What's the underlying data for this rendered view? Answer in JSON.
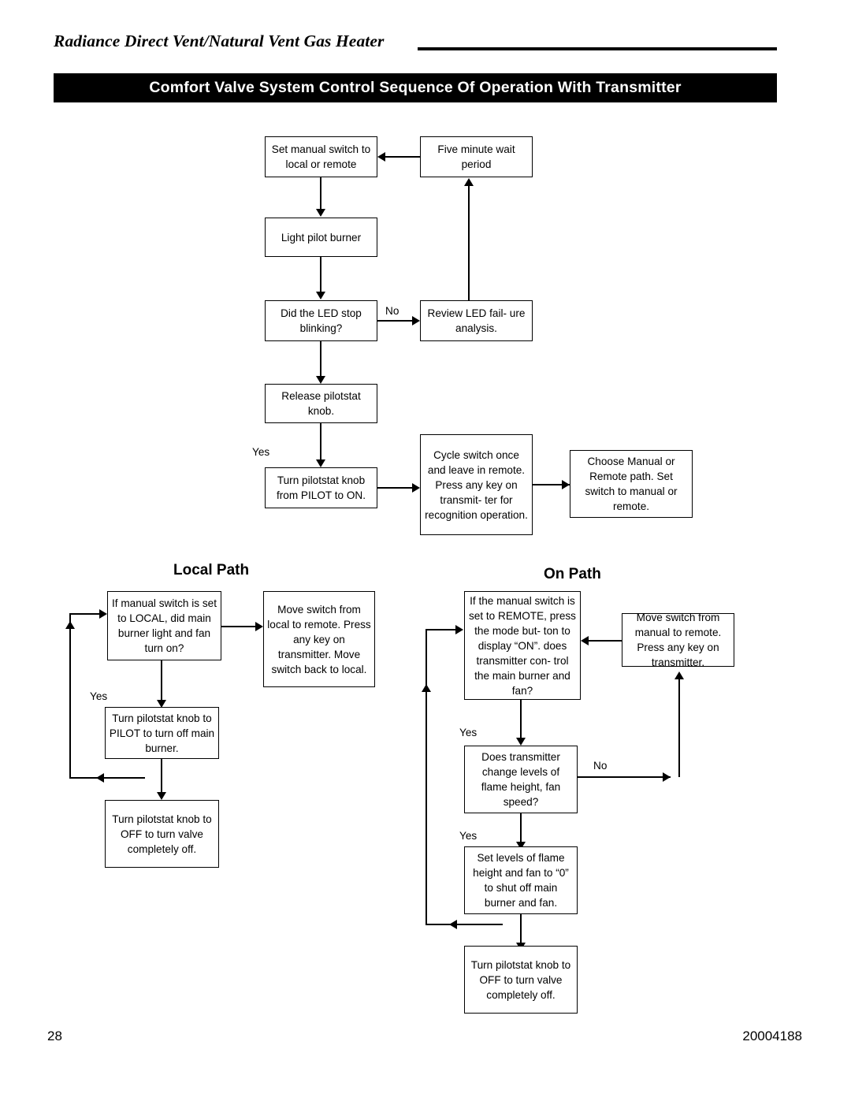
{
  "header": {
    "doc_title": "Radiance Direct Vent/Natural Vent Gas Heater",
    "banner": "Comfort Valve System Control Sequence Of Operation With Transmitter"
  },
  "sections": {
    "local_path": "Local Path",
    "on_path": "On Path"
  },
  "nodes": {
    "set_manual_switch": "Set manual switch to local or remote",
    "five_minute_wait": "Five minute wait period",
    "light_pilot": "Light pilot burner",
    "led_stop": "Did the LED stop blinking?",
    "review_led": "Review LED fail- ure analysis.",
    "release_pilotstat": "Release pilotstat knob.",
    "turn_pilot_to_on": "Turn pilotstat knob from PILOT to ON.",
    "cycle_switch": "Cycle switch once and leave in remote. Press any key on transmit- ter for recognition operation.",
    "choose_manual": "Choose Manual or Remote path. Set switch to manual or remote.",
    "local_check": "If manual switch is set to LOCAL, did main burner light and fan turn on?",
    "move_switch_local": "Move switch from local to remote. Press any key on transmitter. Move switch back to local.",
    "local_pilot": "Turn pilotstat knob to PILOT to turn off main burner.",
    "local_off": "Turn pilotstat knob to OFF to turn valve completely off.",
    "remote_check": "If the manual switch is set to REMOTE, press the mode but- ton to display “ON”. does transmitter con- trol the main burner and fan?",
    "move_switch_remote": "Move switch from manual to remote. Press any key on transmitter.",
    "change_levels": "Does transmitter change levels of flame height, fan speed?",
    "set_levels": "Set levels of flame height and fan to “0” to shut off main burner and fan.",
    "on_off": "Turn pilotstat knob to OFF to turn valve completely off."
  },
  "edge_labels": {
    "no_led": "No",
    "yes_release": "Yes",
    "yes_local": "Yes",
    "yes_remote": "Yes",
    "no_change": "No",
    "yes_change": "Yes"
  },
  "footer": {
    "page_number": "28",
    "doc_code": "20004188"
  }
}
